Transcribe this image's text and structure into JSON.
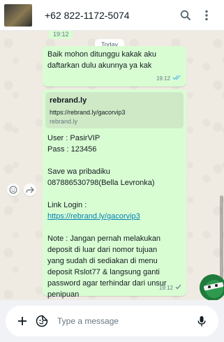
{
  "header": {
    "contact_name": "+62 822-1172-5074"
  },
  "chat": {
    "previous_time": "19:12",
    "date_divider": "Today",
    "messages": [
      {
        "text": "Baik mohon ditunggu kakak aku\ndaftarkan dulu akunnya ya kak",
        "time": "19:12",
        "status": "read"
      },
      {
        "link_preview": {
          "title": "rebrand.ly",
          "url": "https://rebrand.ly/gacorvip3",
          "domain": "rebrand.ly"
        },
        "text_part1": "User : PasirVIP\nPass : 123456\n\nSave wa pribadiku\n087886530798(Bella Levronka)\n\nLink Login :",
        "link_text": "https://rebrand.ly/gacorvip3",
        "text_part2": "\n\nNote : Jangan pernah melakukan\ndeposit di luar dari nomor tujuan\nyang sudah di sediakan di menu\ndeposit Rslot77 & langsung ganti\npassword agar terhindar dari unsur\npenipuan",
        "time": "19:12",
        "status": "sent"
      }
    ]
  },
  "input": {
    "placeholder": "Type a message",
    "value": ""
  },
  "colors": {
    "outgoing_bubble": "#d9fdd3",
    "chat_background": "#efeae2",
    "read_ticks": "#53bdeb",
    "link": "#027eb5"
  },
  "icons": [
    "search-icon",
    "menu-icon",
    "emoji-reaction-icon",
    "forward-icon",
    "plus-icon",
    "sticker-icon",
    "microphone-icon",
    "double-check-icon",
    "single-check-icon"
  ]
}
